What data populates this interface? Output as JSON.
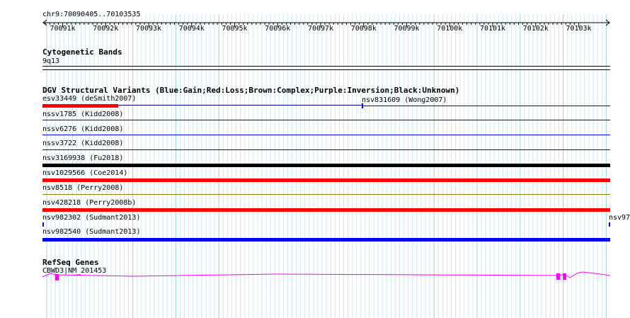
{
  "ruler": {
    "position_label": "chr9:70090405..70103535",
    "ticks": [
      "70091k",
      "70092k",
      "70093k",
      "70094k",
      "70095k",
      "70096k",
      "70097k",
      "70098k",
      "70099k",
      "70100k",
      "70101k",
      "70102k",
      "70103k"
    ]
  },
  "tracks": {
    "cytoband": {
      "title": "Cytogenetic Bands",
      "band_label": "9q13"
    },
    "dgv": {
      "title": "DGV Structural Variants (Blue:Gain;Red:Loss;Brown:Complex;Purple:Inversion;Black:Unknown)",
      "features": [
        {
          "label": "esv33449 (deSmith2007)",
          "color": "#ff0000"
        },
        {
          "label": "nsv831609 (Wong2007)",
          "color": "#0000ff"
        },
        {
          "label": "nssv1785 (Kidd2008)",
          "color": "#0000ff"
        },
        {
          "label": "nssv6276 (Kidd2008)",
          "color": "#0000ff"
        },
        {
          "label": "nssv3722 (Kidd2008)",
          "color": "#0000ff"
        },
        {
          "label": "nsv3169938 (Fu2018)",
          "color": "#000000"
        },
        {
          "label": "nsv1029566 (Coe2014)",
          "color": "#ff0000"
        },
        {
          "label": "nsv8518 (Perry2008)",
          "color": "#ff0000"
        },
        {
          "label": "nsv428218 (Perry2008b)",
          "color": "#ff0000"
        },
        {
          "label": "nsv982302 (Sudmant2013)",
          "color": "#0000ff"
        },
        {
          "label": "nsv97",
          "color": "#0000ff"
        },
        {
          "label": "nsv982540 (Sudmant2013)",
          "color": "#0000ff"
        }
      ]
    },
    "refseq": {
      "title": "RefSeq Genes",
      "gene_label": "CBWD3|NM_201453",
      "color": "#ff00ff"
    }
  }
}
